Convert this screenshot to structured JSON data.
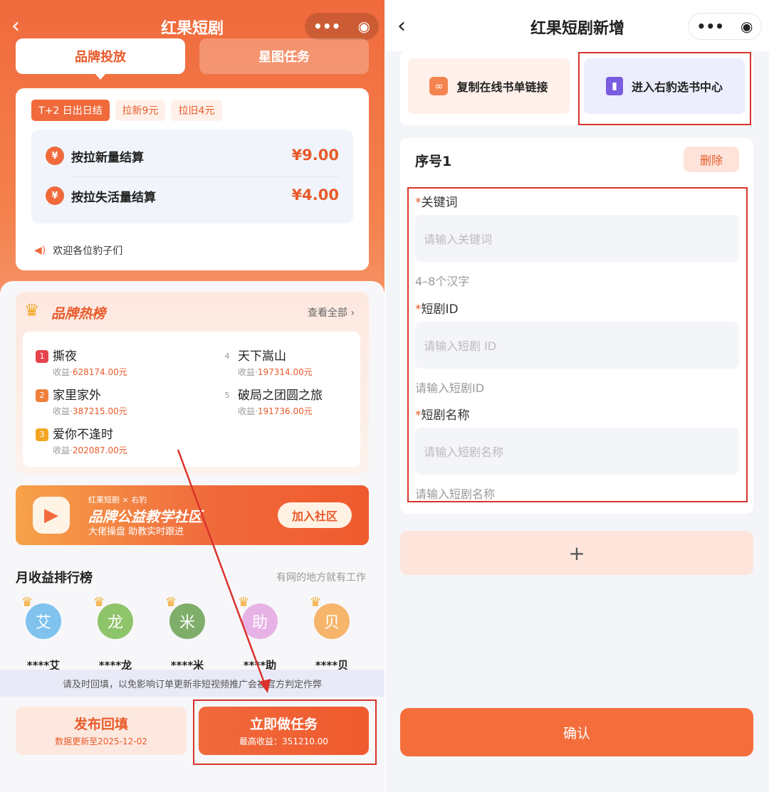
{
  "left": {
    "title": "红果短剧",
    "tabs": [
      "品牌投放",
      "星图任务"
    ],
    "chips": [
      "T+2 日出日结",
      "拉新9元",
      "拉旧4元"
    ],
    "settle": [
      {
        "label": "按拉新量结算",
        "price": "¥9.00"
      },
      {
        "label": "按拉失活量结算",
        "price": "¥4.00"
      }
    ],
    "notice": "欢迎各位豹子们",
    "hot": {
      "title": "品牌热榜",
      "more": "查看全部",
      "income_label": "收益·",
      "items": [
        {
          "rank": "1",
          "name": "撕夜",
          "income": "628174.00元"
        },
        {
          "rank": "2",
          "name": "家里家外",
          "income": "387215.00元"
        },
        {
          "rank": "3",
          "name": "爱你不逢时",
          "income": "202087.00元"
        },
        {
          "rank": "4",
          "name": "天下嵩山",
          "income": "197314.00元"
        },
        {
          "rank": "5",
          "name": "破局之团圆之旅",
          "income": "191736.00元"
        }
      ]
    },
    "banner": {
      "small": "红果短剧 × 右豹",
      "title": "品牌公益教学社区",
      "sub": "大佬操盘 助教实时跟进",
      "button": "加入社区"
    },
    "monthly": {
      "title": "月收益排行榜",
      "subtitle": "有网的地方就有工作",
      "users": [
        {
          "avatar": "艾",
          "name": "****艾",
          "color": "#7fc2ee"
        },
        {
          "avatar": "龙",
          "name": "****龙",
          "color": "#8ec46a"
        },
        {
          "avatar": "米",
          "name": "****米",
          "color": "#7fae6a"
        },
        {
          "avatar": "助",
          "name": "****助",
          "color": "#e7b3e6"
        },
        {
          "avatar": "贝",
          "name": "****贝",
          "color": "#f6b56a"
        }
      ]
    },
    "warning": "请及时回填，以免影响订单更新非短视频推广会被官方判定作弊",
    "publish": {
      "label": "发布回填",
      "sub": "数据更新至2025-12-02"
    },
    "task": {
      "label": "立即做任务",
      "sub": "最高收益：351210.00"
    }
  },
  "right": {
    "title": "红果短剧新增",
    "copy_link": "复制在线书单链接",
    "book_center": "进入右豹选书中心",
    "seq": "序号1",
    "delete": "删除",
    "fields": [
      {
        "label": "关键词",
        "placeholder": "请输入关键词",
        "hint": "4–8个汉字"
      },
      {
        "label": "短剧ID",
        "placeholder": "请输入短剧 ID",
        "hint": "请输入短剧ID"
      },
      {
        "label": "短剧名称",
        "placeholder": "请输入短剧名称",
        "hint": "请输入短剧名称"
      }
    ],
    "add": "+",
    "confirm": "确认"
  },
  "colors": {
    "accent": "#f06a3c",
    "annotation": "#d9332b"
  }
}
